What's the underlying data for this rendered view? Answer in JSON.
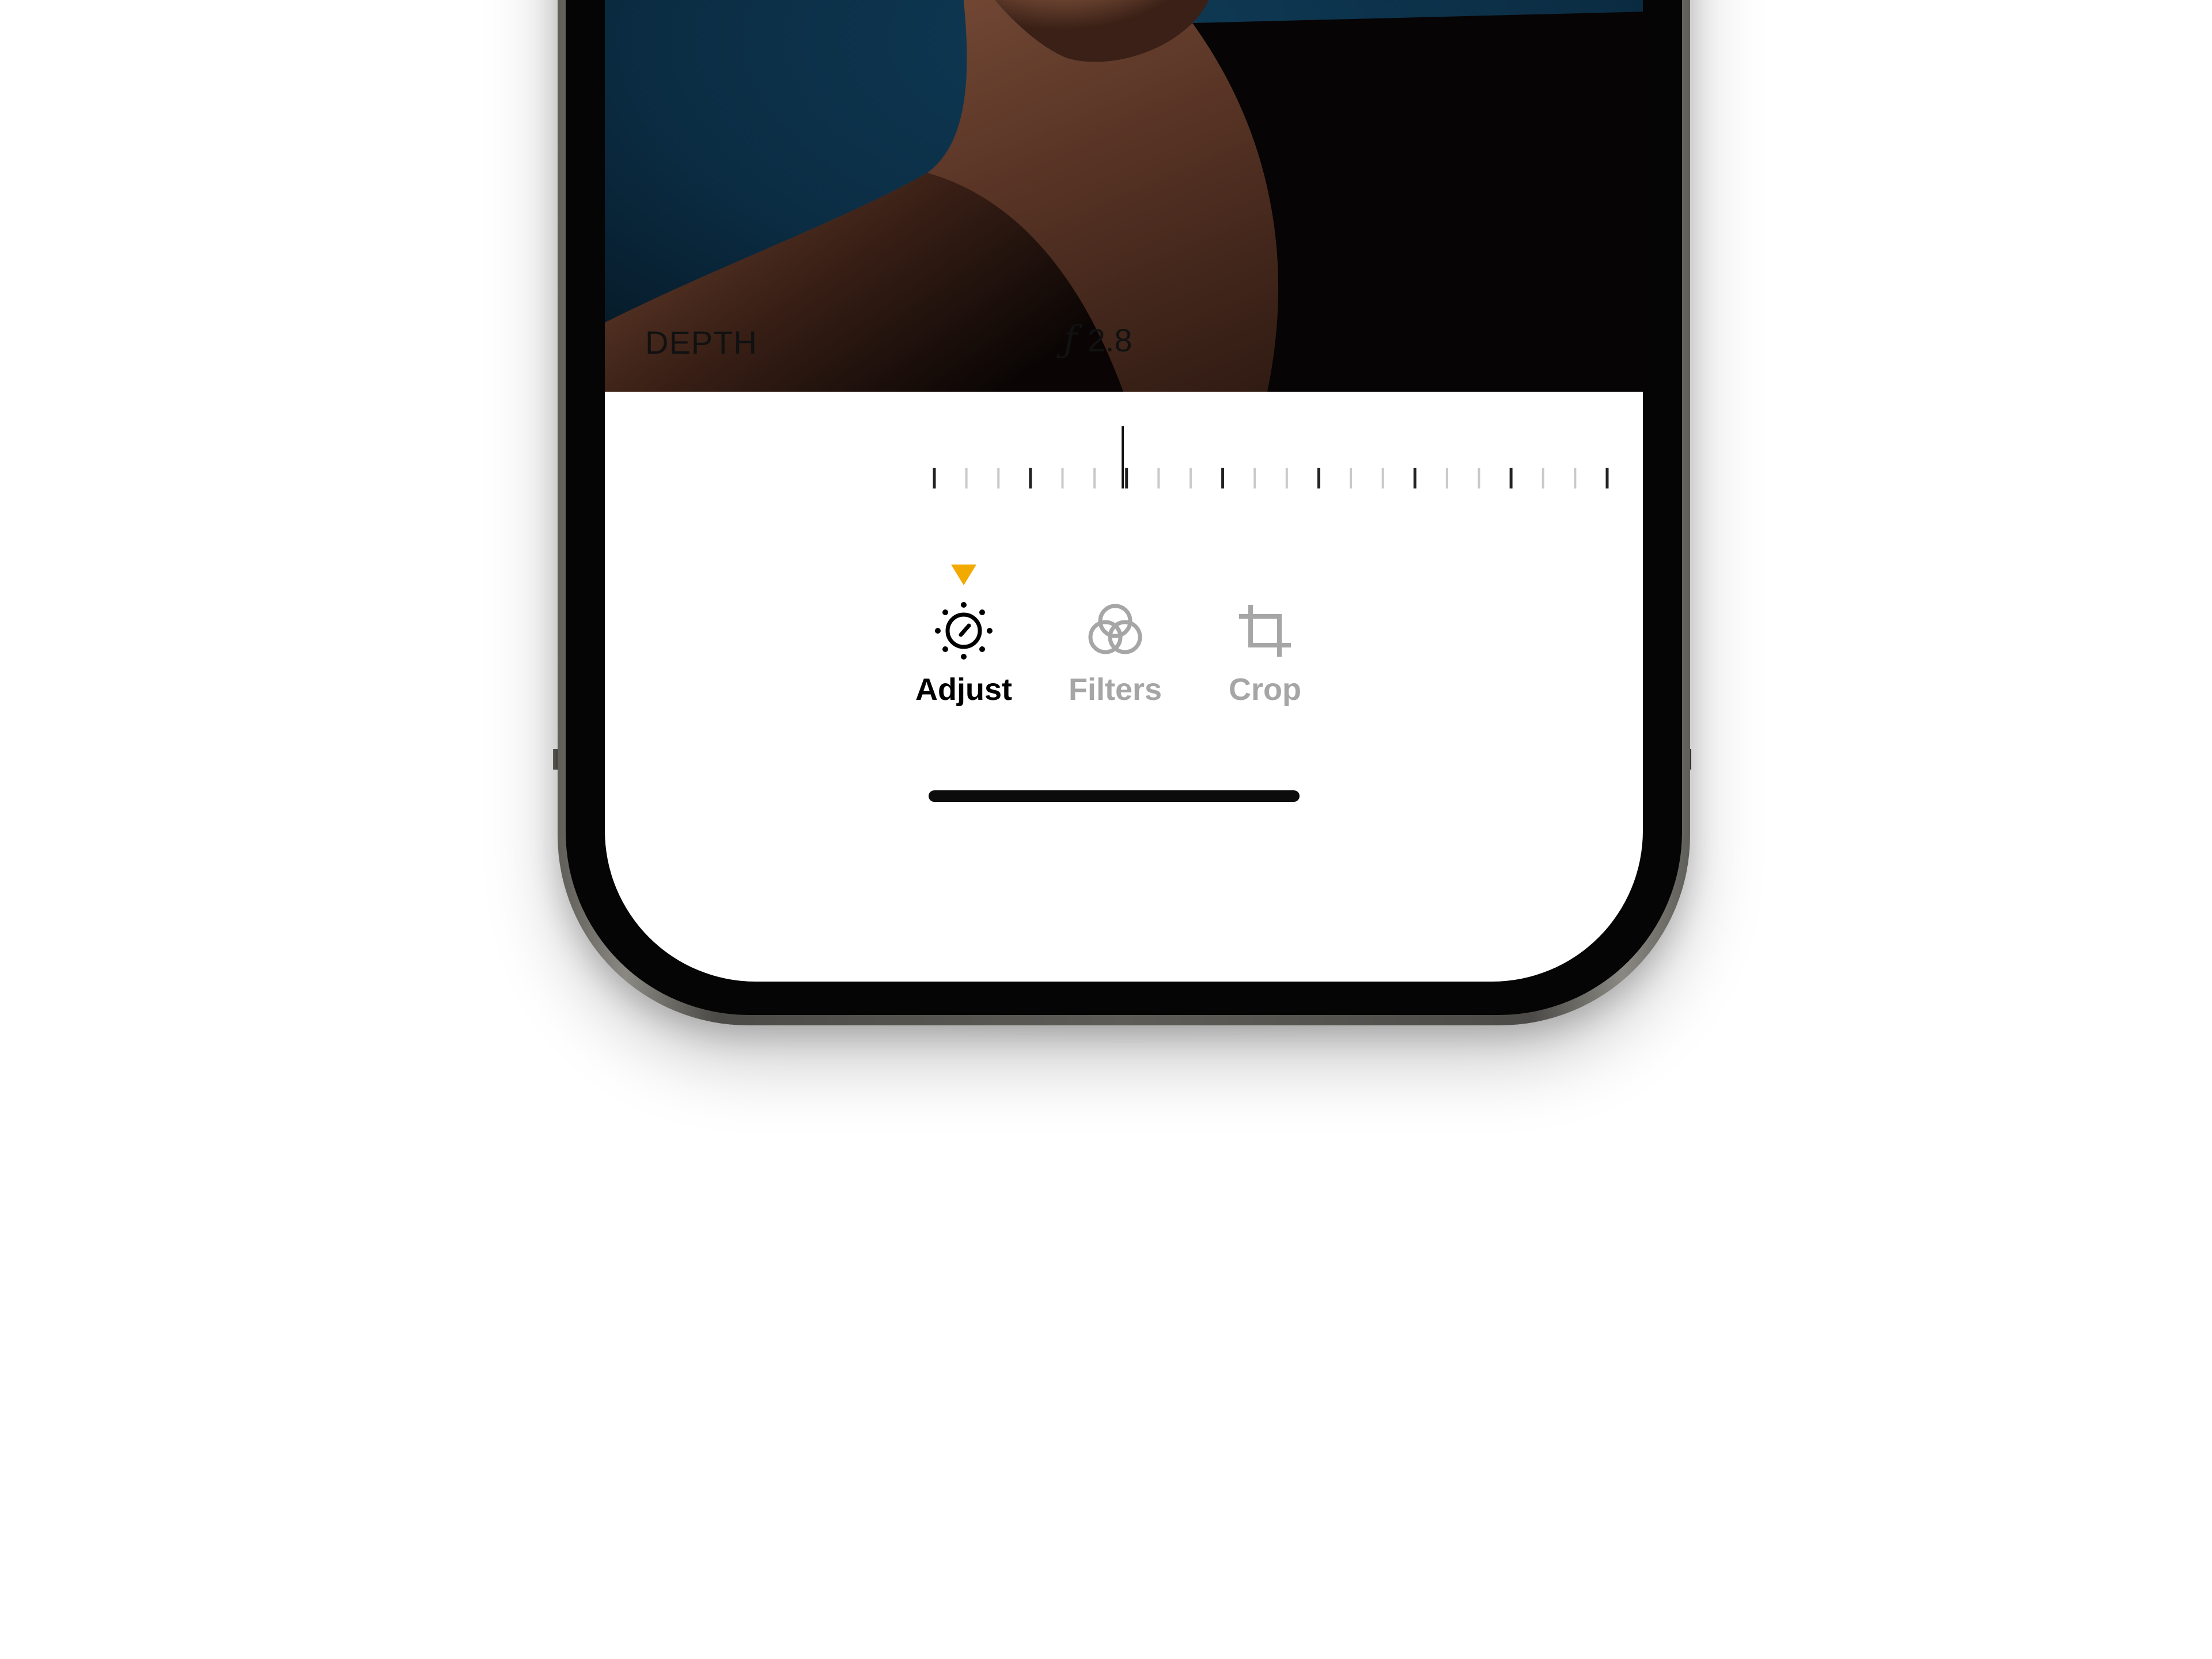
{
  "colors": {
    "accent": "#f2a900",
    "active_text": "#000000",
    "inactive_text": "#a6a6a6",
    "photo_background": "#0b3148"
  },
  "editor": {
    "parameter_label": "DEPTH",
    "aperture_icon": "aperture-f-icon",
    "aperture_glyph": "ƒ",
    "aperture_value": "2.8"
  },
  "slider": {
    "position": 0.28
  },
  "tabs": [
    {
      "label": "Adjust",
      "icon": "adjust-dial-icon",
      "active": true
    },
    {
      "label": "Filters",
      "icon": "filters-circles-icon",
      "active": false
    },
    {
      "label": "Crop",
      "icon": "crop-icon",
      "active": false
    }
  ]
}
